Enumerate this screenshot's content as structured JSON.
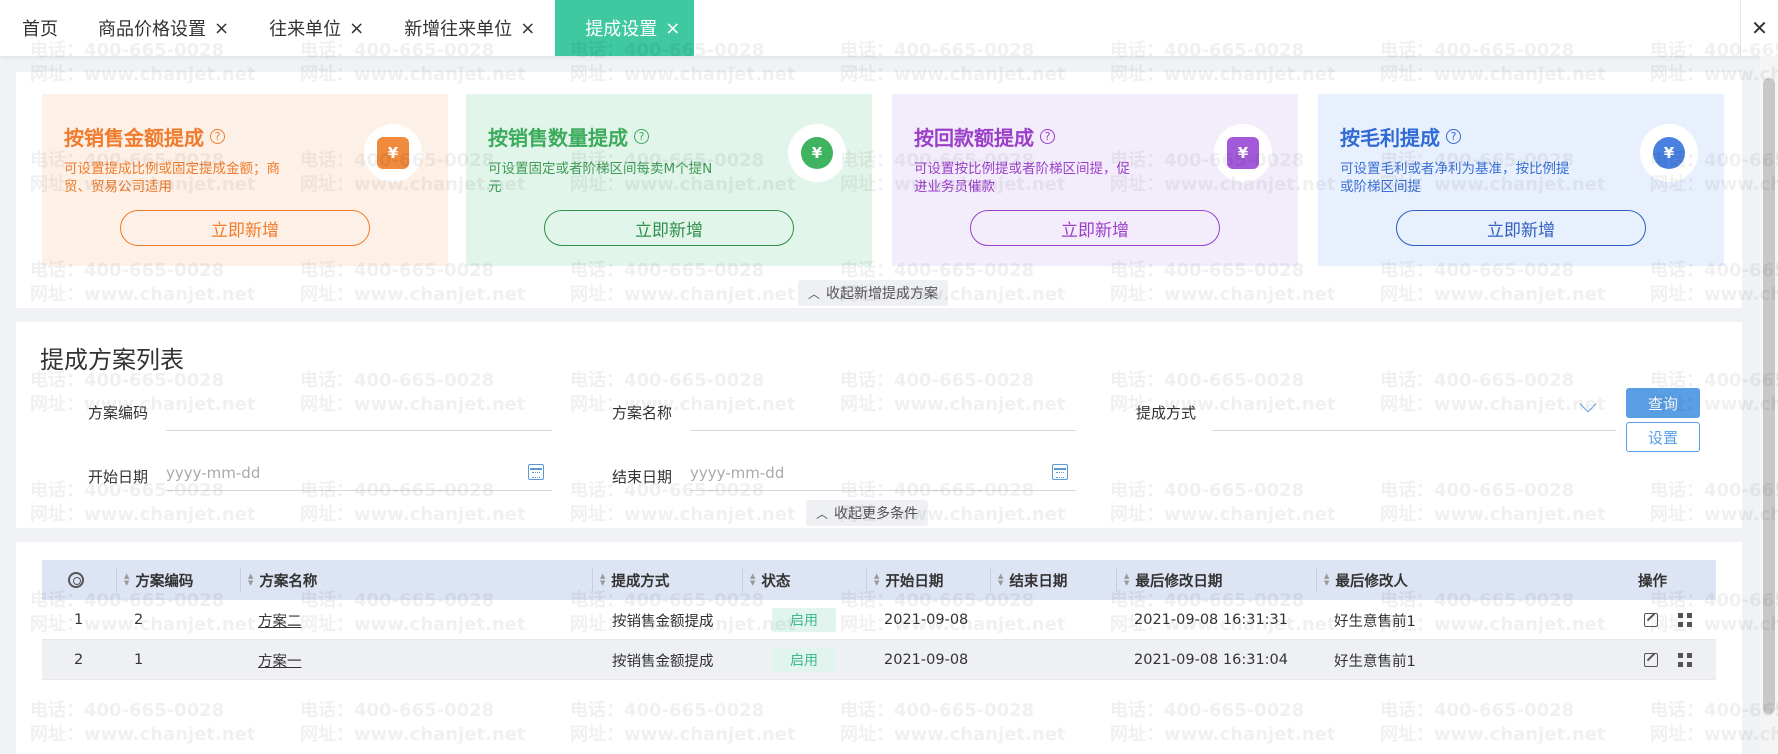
{
  "tabs": [
    {
      "label": "首页",
      "closable": false
    },
    {
      "label": "商品价格设置",
      "closable": true
    },
    {
      "label": "往来单位",
      "closable": true
    },
    {
      "label": "新增往来单位",
      "closable": true
    },
    {
      "label": "提成设置",
      "closable": true,
      "active": true
    }
  ],
  "tab_close_glyph": "×",
  "close_all_glyph": "✕",
  "cards": [
    {
      "title": "按销售金额提成",
      "desc": "可设置提成比例或固定提成金额；商贸、贸易公司适用",
      "button": "立即新增",
      "icon": "cash-box-icon",
      "glyph": "¥",
      "color": "#f07b2c"
    },
    {
      "title": "按销售数量提成",
      "desc": "可设置固定或者阶梯区间每卖M个提N元",
      "button": "立即新增",
      "icon": "money-house-icon",
      "glyph": "¥",
      "color": "#3cab5c"
    },
    {
      "title": "按回款额提成",
      "desc": "可设置按比例提或者阶梯区间提，促进业务员催款",
      "button": "立即新增",
      "icon": "calendar-money-icon",
      "glyph": "¥",
      "color": "#9b3fc9"
    },
    {
      "title": "按毛利提成",
      "desc": "可设置毛利或者净利为基准，按比例提或阶梯区间提",
      "button": "立即新增",
      "icon": "money-bag-icon",
      "glyph": "¥",
      "color": "#2f6ad7"
    }
  ],
  "help_glyph": "?",
  "collapse_new_label": "收起新增提成方案",
  "collapse_chevron": "︿",
  "list_title": "提成方案列表",
  "filters": {
    "code_label": "方案编码",
    "name_label": "方案名称",
    "method_label": "提成方式",
    "start_label": "开始日期",
    "end_label": "结束日期",
    "date_placeholder": "yyyy-mm-dd",
    "query_button": "查询",
    "settings_button": "设置",
    "collapse_more_label": "收起更多条件"
  },
  "table": {
    "headers": [
      "方案编码",
      "方案名称",
      "提成方式",
      "状态",
      "开始日期",
      "结束日期",
      "最后修改日期",
      "最后修改人",
      "操作"
    ],
    "rows": [
      {
        "index": "1",
        "code": "2",
        "name": "方案二",
        "method": "按销售金额提成",
        "status": "启用",
        "start": "2021-09-08",
        "end": "",
        "modified": "2021-09-08 16:31:31",
        "modifier": "好生意售前1"
      },
      {
        "index": "2",
        "code": "1",
        "name": "方案一",
        "method": "按销售金额提成",
        "status": "启用",
        "start": "2021-09-08",
        "end": "",
        "modified": "2021-09-08 16:31:04",
        "modifier": "好生意售前1"
      }
    ]
  },
  "watermark": {
    "phone": "电话：400-665-0028",
    "site": "网址：www.chanjet.net"
  },
  "colors": {
    "accent": "#40c8a0",
    "primary": "#5a9ee6",
    "status_bg": "#e1f5ee",
    "status_text": "#40b890"
  }
}
